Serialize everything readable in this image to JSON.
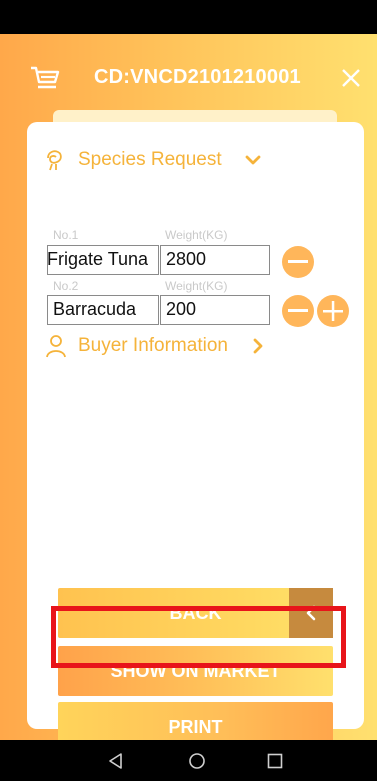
{
  "header": {
    "title": "CD:VNCD2101210001",
    "cart_icon": "cart-icon",
    "close_icon": "close-icon"
  },
  "species_section": {
    "label": "Species Request",
    "items": [
      {
        "no_label": "No.1",
        "weight_label": "Weight(KG)",
        "species": "Frigate Tuna",
        "weight": "2800"
      },
      {
        "no_label": "No.2",
        "weight_label": "Weight(KG)",
        "species": "Barracuda",
        "weight": "200"
      }
    ]
  },
  "buyer_section": {
    "label": "Buyer Information"
  },
  "buttons": {
    "back": "BACK",
    "show_on_market": "SHOW ON MARKET",
    "print": "PRINT"
  },
  "colors": {
    "accent": "#f5b33a",
    "highlight": "#e8141a",
    "back_arrow": "#c68a3e"
  }
}
